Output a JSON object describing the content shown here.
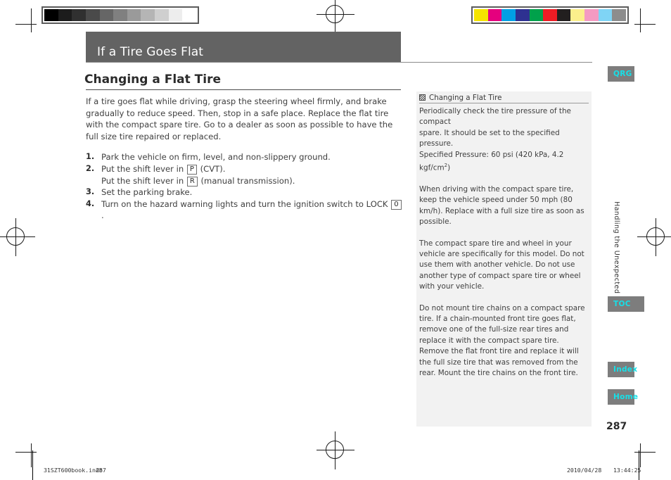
{
  "page": {
    "chapter_band_title": "If a Tire Goes Flat",
    "section_title": "Changing a Flat Tire",
    "page_number": "287",
    "side_tab_label": "Handling the Unexpected"
  },
  "main": {
    "intro": "If a tire goes flat while driving, grasp the steering wheel firmly, and brake gradually to reduce speed. Then, stop in a safe place. Replace the flat tire with the compact spare tire. Go to a dealer as soon as possible to have the full size tire repaired or replaced.",
    "steps": [
      {
        "num": "1.",
        "lines": [
          {
            "pre": "Park the vehicle on firm, level, and non-slippery ground.",
            "key": "",
            "post": ""
          }
        ]
      },
      {
        "num": "2.",
        "lines": [
          {
            "pre": "Put the shift lever in ",
            "key": "P",
            "post": " (CVT)."
          },
          {
            "pre": "Put the shift lever in ",
            "key": "R",
            "post": " (manual transmission)."
          }
        ]
      },
      {
        "num": "3.",
        "lines": [
          {
            "pre": "Set the parking brake.",
            "key": "",
            "post": ""
          }
        ]
      },
      {
        "num": "4.",
        "lines": [
          {
            "pre": "Turn on the hazard warning lights and turn the ignition switch to LOCK ",
            "key": "0",
            "post": "."
          }
        ]
      }
    ]
  },
  "info_panel": {
    "icon": "hatched-square-icon",
    "heading": "Changing a Flat Tire",
    "paragraphs": [
      "Periodically check the tire pressure of the compact spare. It should be set to the specified pressure. Specified Pressure: 60 psi (420 kPa, 4.2 kgf/cm2)",
      "When driving with the compact spare tire, keep the vehicle speed under 50 mph (80 km/h). Replace with a full size tire as soon as possible.",
      "The compact spare tire and wheel in your vehicle are specifically for this model. Do not use them with another vehicle. Do not use another type of compact spare tire or wheel with your vehicle.",
      "Do not mount tire chains on a compact spare tire. If a chain-mounted front tire goes flat, remove one of the full-size rear tires and replace it with the compact spare tire. Remove the flat front tire and replace it will the full size tire that was removed from the rear. Mount the tire chains on the front tire."
    ],
    "pressure_note": {
      "line1": "Periodically check the tire pressure of the compact",
      "line2": "spare. It should be set to the specified pressure.",
      "line3_pre": "Specified Pressure: 60 psi (420 kPa, 4.2 kgf/cm",
      "line3_sup": "2",
      "line3_post": ")"
    },
    "para2": "When driving with the compact spare tire, keep the vehicle speed under 50 mph (80 km/h). Replace with a full size tire as soon as possible.",
    "para3": "The compact spare tire and wheel in your vehicle are specifically for this model. Do not use them with another vehicle. Do not use another type of compact spare tire or wheel with your vehicle.",
    "para4": "Do not mount tire chains on a compact spare tire. If a chain-mounted front tire goes flat, remove one of the full-size rear tires and replace it with the compact spare tire. Remove the flat front tire and replace it will the full size tire that was removed from the rear. Mount the tire chains on the front tire."
  },
  "nav_buttons": {
    "qrg": "QRG",
    "toc": "TOC",
    "index": "Index",
    "home": "Home",
    "background": "#7d7d7d",
    "text_color": "#16e0e8"
  },
  "footer": {
    "file_name": "31SZT600book.indb",
    "page": "287",
    "date": "2010/04/28",
    "time": "13:44:25"
  },
  "calibration": {
    "gray_steps": [
      "#000000",
      "#1c1c1c",
      "#303030",
      "#4a4a4a",
      "#666666",
      "#808080",
      "#9a9a9a",
      "#b5b5b5",
      "#cfcfcf",
      "#ededed",
      "#ffffff"
    ],
    "color_steps": [
      "#f5e400",
      "#e5007e",
      "#00a0e4",
      "#2e3191",
      "#00a14b",
      "#ed1c24",
      "#221f1f",
      "#fbef8c",
      "#f49ac2",
      "#7fd4f5",
      "#8d8d8d"
    ]
  }
}
